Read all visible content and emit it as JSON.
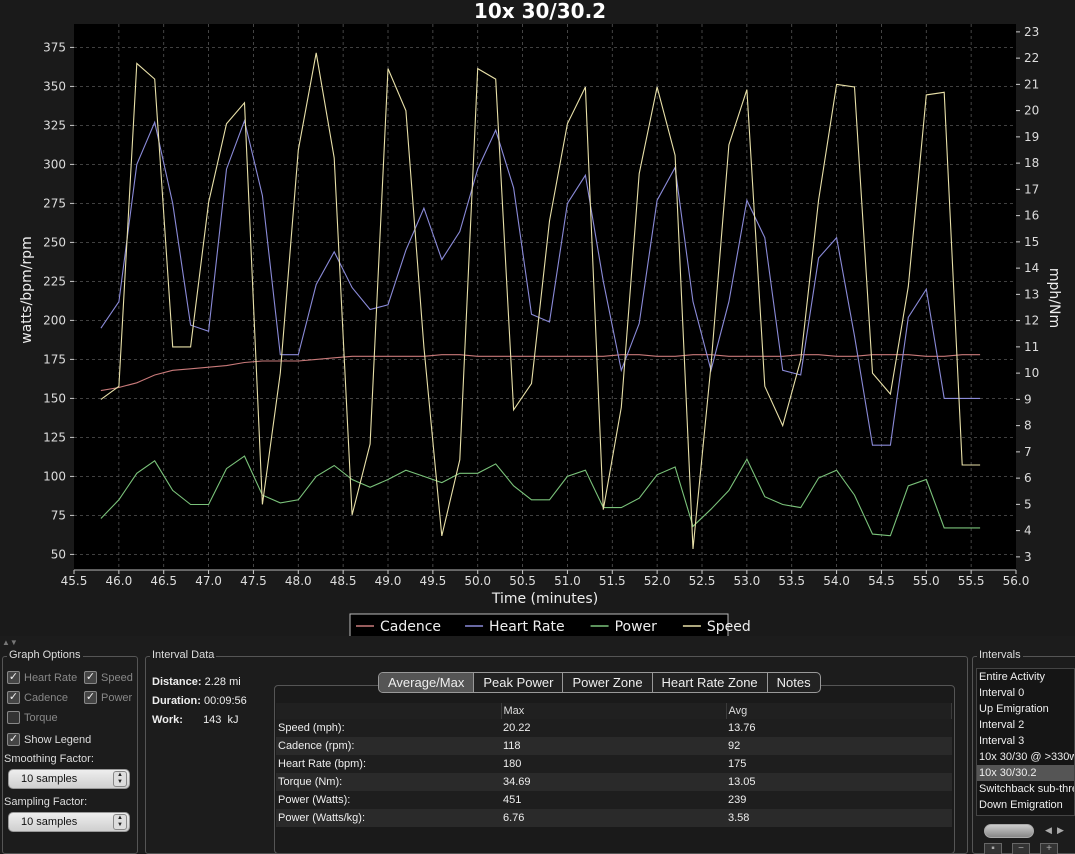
{
  "chart_data": {
    "type": "line",
    "title": "10x 30/30.2",
    "xlabel": "Time (minutes)",
    "ylabel_left": "watts/bpm/rpm",
    "ylabel_right": "mph/Nm",
    "xlim": [
      45.5,
      56.0
    ],
    "ylim_left": [
      40,
      390
    ],
    "ylim_right": [
      2.5,
      23.3
    ],
    "x_ticks": [
      "45.5",
      "46.0",
      "46.5",
      "47.0",
      "47.5",
      "48.0",
      "48.5",
      "49.0",
      "49.5",
      "50.0",
      "50.5",
      "51.0",
      "51.5",
      "52.0",
      "52.5",
      "53.0",
      "53.5",
      "54.0",
      "54.5",
      "55.0",
      "55.5",
      "56.0"
    ],
    "y_left_ticks": [
      "50",
      "75",
      "100",
      "125",
      "150",
      "175",
      "200",
      "225",
      "250",
      "275",
      "300",
      "325",
      "350",
      "375"
    ],
    "y_right_ticks": [
      "3",
      "4",
      "5",
      "6",
      "7",
      "8",
      "9",
      "10",
      "11",
      "12",
      "13",
      "14",
      "15",
      "16",
      "17",
      "18",
      "19",
      "20",
      "21",
      "22",
      "23"
    ],
    "grid": true,
    "legend_position": "bottom",
    "x": [
      45.8,
      46.0,
      46.2,
      46.4,
      46.6,
      46.8,
      47.0,
      47.2,
      47.4,
      47.6,
      47.8,
      48.0,
      48.2,
      48.4,
      48.6,
      48.8,
      49.0,
      49.2,
      49.4,
      49.6,
      49.8,
      50.0,
      50.2,
      50.4,
      50.6,
      50.8,
      51.0,
      51.2,
      51.4,
      51.6,
      51.8,
      52.0,
      52.2,
      52.4,
      52.6,
      52.8,
      53.0,
      53.2,
      53.4,
      53.6,
      53.8,
      54.0,
      54.2,
      54.4,
      54.6,
      54.8,
      55.0,
      55.2,
      55.4,
      55.6
    ],
    "series": [
      {
        "name": "Cadence",
        "axis": "left",
        "color": "#c97a7a",
        "values": [
          155,
          157,
          160,
          165,
          168,
          169,
          170,
          171,
          173,
          174,
          174,
          174,
          175,
          176,
          177,
          177,
          177,
          177,
          177,
          178,
          178,
          177,
          177,
          177,
          177,
          177,
          177,
          177,
          177,
          178,
          178,
          177,
          177,
          178,
          178,
          177,
          177,
          177,
          177,
          178,
          178,
          177,
          177,
          178,
          178,
          178,
          177,
          177,
          178,
          178
        ]
      },
      {
        "name": "Heart Rate",
        "axis": "left",
        "color": "#8a8ad8",
        "values": [
          195,
          212,
          300,
          327,
          275,
          197,
          193,
          297,
          328,
          280,
          178,
          178,
          223,
          244,
          221,
          207,
          210,
          245,
          272,
          239,
          257,
          297,
          322,
          285,
          204,
          199,
          275,
          293,
          225,
          168,
          198,
          277,
          298,
          212,
          168,
          212,
          277,
          253,
          168,
          165,
          240,
          253,
          190,
          120,
          120,
          202,
          220,
          150,
          150,
          150
        ]
      },
      {
        "name": "Power",
        "axis": "left",
        "color": "#7ac27a",
        "values": [
          73,
          85,
          102,
          110,
          91,
          82,
          82,
          105,
          113,
          88,
          83,
          85,
          100,
          107,
          98,
          93,
          98,
          104,
          100,
          96,
          102,
          102,
          108,
          94,
          85,
          85,
          100,
          104,
          80,
          80,
          86,
          101,
          106,
          68,
          79,
          91,
          111,
          87,
          82,
          80,
          99,
          104,
          88,
          63,
          62,
          94,
          98,
          67,
          67,
          67
        ]
      },
      {
        "name": "Speed",
        "axis": "right",
        "color": "#e8e0a8",
        "values": [
          9.0,
          9.5,
          21.8,
          21.2,
          11.0,
          11.0,
          16.5,
          19.5,
          20.3,
          5.0,
          10.0,
          18.5,
          22.2,
          18.2,
          4.6,
          7.3,
          21.6,
          20.0,
          11.0,
          3.8,
          6.7,
          21.6,
          21.2,
          8.6,
          9.6,
          15.8,
          19.5,
          20.9,
          4.8,
          8.7,
          17.6,
          20.9,
          18.3,
          3.3,
          10.3,
          18.7,
          20.8,
          9.5,
          8.0,
          10.5,
          16.6,
          21.0,
          20.9,
          10.0,
          9.2,
          13.3,
          20.6,
          20.7,
          6.5,
          6.5
        ]
      }
    ]
  },
  "legend": {
    "items": [
      {
        "label": "Cadence",
        "color": "#c97a7a"
      },
      {
        "label": "Heart Rate",
        "color": "#8a8ad8"
      },
      {
        "label": "Power",
        "color": "#7ac27a"
      },
      {
        "label": "Speed",
        "color": "#e8e0a8"
      }
    ]
  },
  "graph_options": {
    "title": "Graph Options",
    "heart_rate": "Heart Rate",
    "speed": "Speed",
    "cadence": "Cadence",
    "power": "Power",
    "torque": "Torque",
    "show_legend": "Show Legend",
    "smoothing_label": "Smoothing Factor:",
    "smoothing_value": "10 samples",
    "sampling_label": "Sampling Factor:",
    "sampling_value": "10 samples"
  },
  "interval_data": {
    "title": "Interval Data",
    "distance_label": "Distance:",
    "distance_value": "2.28",
    "distance_unit": "mi",
    "duration_label": "Duration:",
    "duration_value": "00:09:56",
    "work_label": "Work:",
    "work_value": "143",
    "work_unit": "kJ"
  },
  "tabs": [
    "Average/Max",
    "Peak Power",
    "Power Zone",
    "Heart Rate Zone",
    "Notes"
  ],
  "stats_table": {
    "headers": [
      "",
      "Max",
      "Avg"
    ],
    "rows": [
      [
        "Speed (mph):",
        "20.22",
        "13.76"
      ],
      [
        "Cadence (rpm):",
        "118",
        "92"
      ],
      [
        "Heart Rate (bpm):",
        "180",
        "175"
      ],
      [
        "Torque (Nm):",
        "34.69",
        "13.05"
      ],
      [
        "Power (Watts):",
        "451",
        "239"
      ],
      [
        "Power (Watts/kg):",
        "6.76",
        "3.58"
      ]
    ]
  },
  "intervals": {
    "title": "Intervals",
    "items": [
      "Entire Activity",
      "Interval 0",
      "Up Emigration",
      "Interval 2",
      "Interval 3",
      "10x 30/30 @ >330w",
      "10x 30/30.2",
      "Switchback sub-threshold",
      "Down Emigration"
    ],
    "selected": "10x 30/30.2"
  }
}
